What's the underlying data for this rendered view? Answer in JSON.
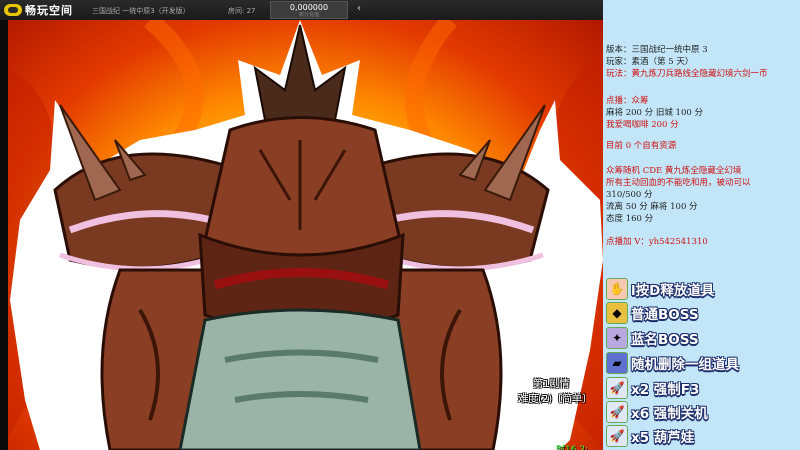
{
  "topbar": {
    "logo_text": "畅玩空间",
    "game_title": "三国战纪 一统中原3（开发版）",
    "room_label": "房间: 27",
    "score_value": "0,000000",
    "score_sub": "积分充值",
    "nav_prev": "‹"
  },
  "game": {
    "story_text": "第1剧情",
    "difficulty_text": "难度(2)〔简单〕",
    "corner_text": "时16 2:"
  },
  "panel": {
    "version": "版本：三国战纪一统中原 3",
    "player": "玩家：素酒（第 5 天）",
    "play_line1": "玩法：黄九炼刀兵路线全隐藏幻境六剑一币",
    "order_title": "点播：众筹",
    "order_1": "麻将  200 分    旧城  100 分",
    "order_2": "我爱喝咖啡  200 分",
    "resources": "目前 0 个自有资源",
    "crowd_1": "众筹随机 CDE 黄九炼全隐藏全幻境",
    "crowd_2": "所有主动回血的不能吃和用，被动可以",
    "crowd_3": "310/500 分",
    "crowd_4": "流离  50 分    麻将  100 分",
    "crowd_5": "态度  160 分",
    "contact": "点播加 V：yh542541310"
  },
  "gifts": [
    {
      "text": "l按D释放道具",
      "icon": "hand-gift-icon"
    },
    {
      "text": "普通BOSS",
      "icon": "gold-gift-icon"
    },
    {
      "text": "蓝名BOSS",
      "icon": "dragon-gift-icon"
    },
    {
      "text": "随机删除一组道具",
      "icon": "car-gift-icon"
    },
    {
      "text": "x2 强制F3",
      "icon": "rocket-gift-icon"
    },
    {
      "text": "x6 强制关机",
      "icon": "rocket-gift-icon"
    },
    {
      "text": "x5 葫芦娃",
      "icon": "rocket-gift-icon"
    }
  ],
  "colors": {
    "panel_bg": "#c2e6f8",
    "panel_red": "#d01010",
    "panel_dark": "#222222",
    "gift_outline": "#1c2d6a"
  }
}
